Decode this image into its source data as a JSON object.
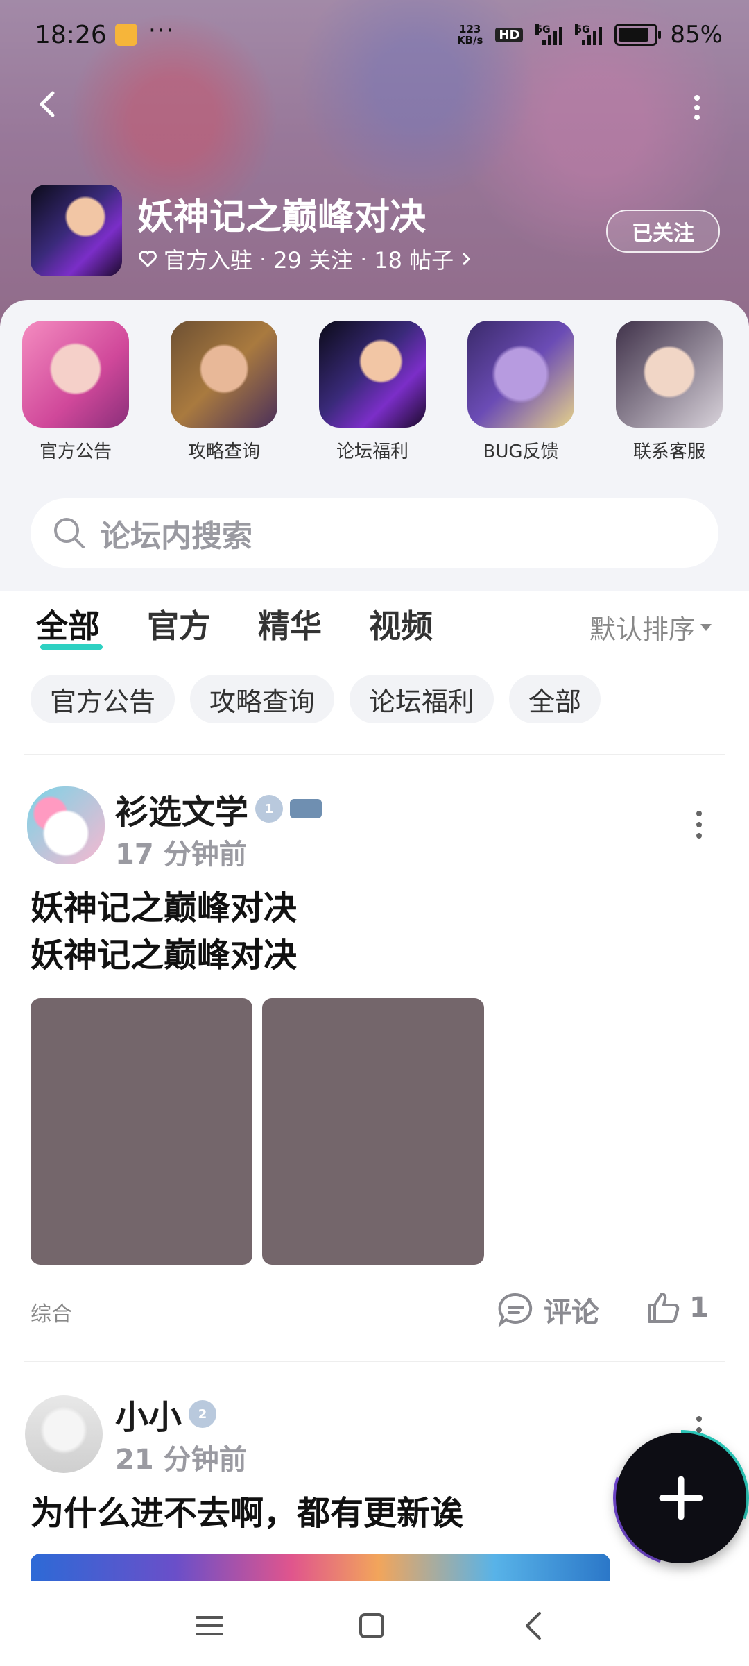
{
  "status_bar": {
    "time": "18:26",
    "dots": "···",
    "net_speed_value": "123",
    "net_speed_unit": "KB/s",
    "hd_label": "HD",
    "signal_1_label": "5G",
    "signal_2_label": "5G",
    "battery_percent": "85%",
    "battery_level": 0.85
  },
  "header": {
    "game_title": "妖神记之巅峰对决",
    "meta_official": "官方入驻",
    "meta_separator_1": "·",
    "meta_follow": "29 关注",
    "meta_separator_2": "·",
    "meta_posts": "18 帖子",
    "follow_button": "已关注"
  },
  "shortcuts": [
    {
      "label": "官方公告"
    },
    {
      "label": "攻略查询"
    },
    {
      "label": "论坛福利"
    },
    {
      "label": "BUG反馈"
    },
    {
      "label": "联系客服"
    }
  ],
  "search": {
    "placeholder": "论坛内搜索"
  },
  "tabs": [
    {
      "label": "全部",
      "active": true
    },
    {
      "label": "官方"
    },
    {
      "label": "精华"
    },
    {
      "label": "视频"
    }
  ],
  "sort": {
    "label": "默认排序"
  },
  "chips": [
    "官方公告",
    "攻略查询",
    "论坛福利",
    "全部"
  ],
  "posts": [
    {
      "username": "衫选文学",
      "level_badge": "1",
      "time": "17 分钟前",
      "text_line1": "妖神记之巅峰对决",
      "text_line2": "妖神记之巅峰对决",
      "category": "综合",
      "comment_label": "评论",
      "like_count": "1"
    },
    {
      "username": "小小",
      "level_badge": "2",
      "time": "21 分钟前",
      "text": "为什么进不去啊，都有更新诶"
    }
  ],
  "colors": {
    "accent": "#2ed1c2",
    "image_placeholder": "#74666b"
  },
  "icons": [
    "back-icon",
    "more-icon",
    "heart-icon",
    "chevron-right-icon",
    "search-icon",
    "comment-icon",
    "thumbs-up-icon",
    "plus-icon",
    "menu-icon",
    "home-icon",
    "nav-back-icon"
  ]
}
